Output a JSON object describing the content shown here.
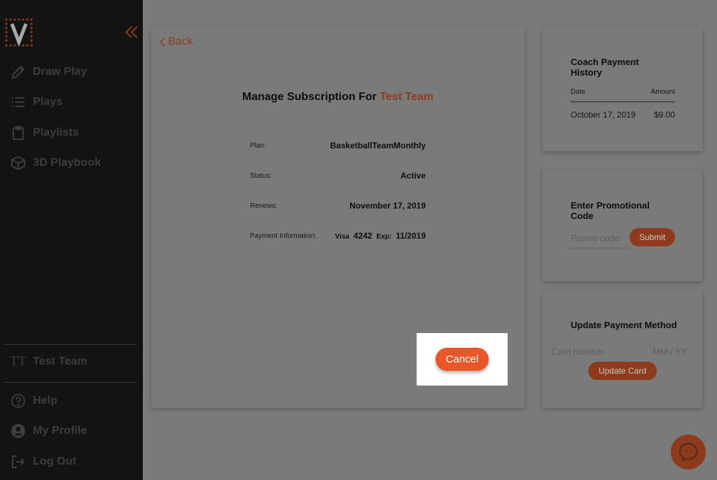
{
  "sidebar": {
    "nav": [
      {
        "label": "Draw Play",
        "icon": "pencil-icon"
      },
      {
        "label": "Plays",
        "icon": "list-icon"
      },
      {
        "label": "Playlists",
        "icon": "clipboard-icon"
      },
      {
        "label": "3D Playbook",
        "icon": "cube-icon"
      }
    ],
    "team": {
      "initials": "TT",
      "label": "Test Team"
    },
    "bottom": [
      {
        "label": "Help",
        "icon": "question-icon"
      },
      {
        "label": "My Profile",
        "icon": "user-icon"
      },
      {
        "label": "Log Out",
        "icon": "logout-icon"
      }
    ]
  },
  "main": {
    "back_label": "Back",
    "title_prefix": "Manage Subscription For ",
    "title_team": "Test Team",
    "plan_label": "Plan:",
    "plan_value": "BasketballTeamMonthly",
    "status_label": "Status:",
    "status_value": "Active",
    "renews_label": "Renews:",
    "renews_value": "November 17, 2019",
    "payment_label": "Payment Information:",
    "payment_brand": "Visa",
    "payment_last4": "4242",
    "payment_exp_label": "Exp:",
    "payment_exp": "11/2019",
    "cancel_label": "Cancel"
  },
  "history": {
    "title": "Coach Payment History",
    "date_header": "Date",
    "amount_header": "Amount",
    "rows": [
      {
        "date": "October 17, 2019",
        "amount": "$9.00"
      }
    ]
  },
  "promo": {
    "title": "Enter Promotional Code",
    "placeholder": "Promo code",
    "submit_label": "Submit"
  },
  "payment_method": {
    "title": "Update Payment Method",
    "card_placeholder": "Card number",
    "expiry_placeholder": "MM / YY",
    "update_label": "Update Card"
  },
  "colors": {
    "accent": "#e8562a",
    "accent_dim": "#8e3a1c",
    "sidebar_bg": "#131313",
    "overlay_bg": "#7a7a7a"
  }
}
